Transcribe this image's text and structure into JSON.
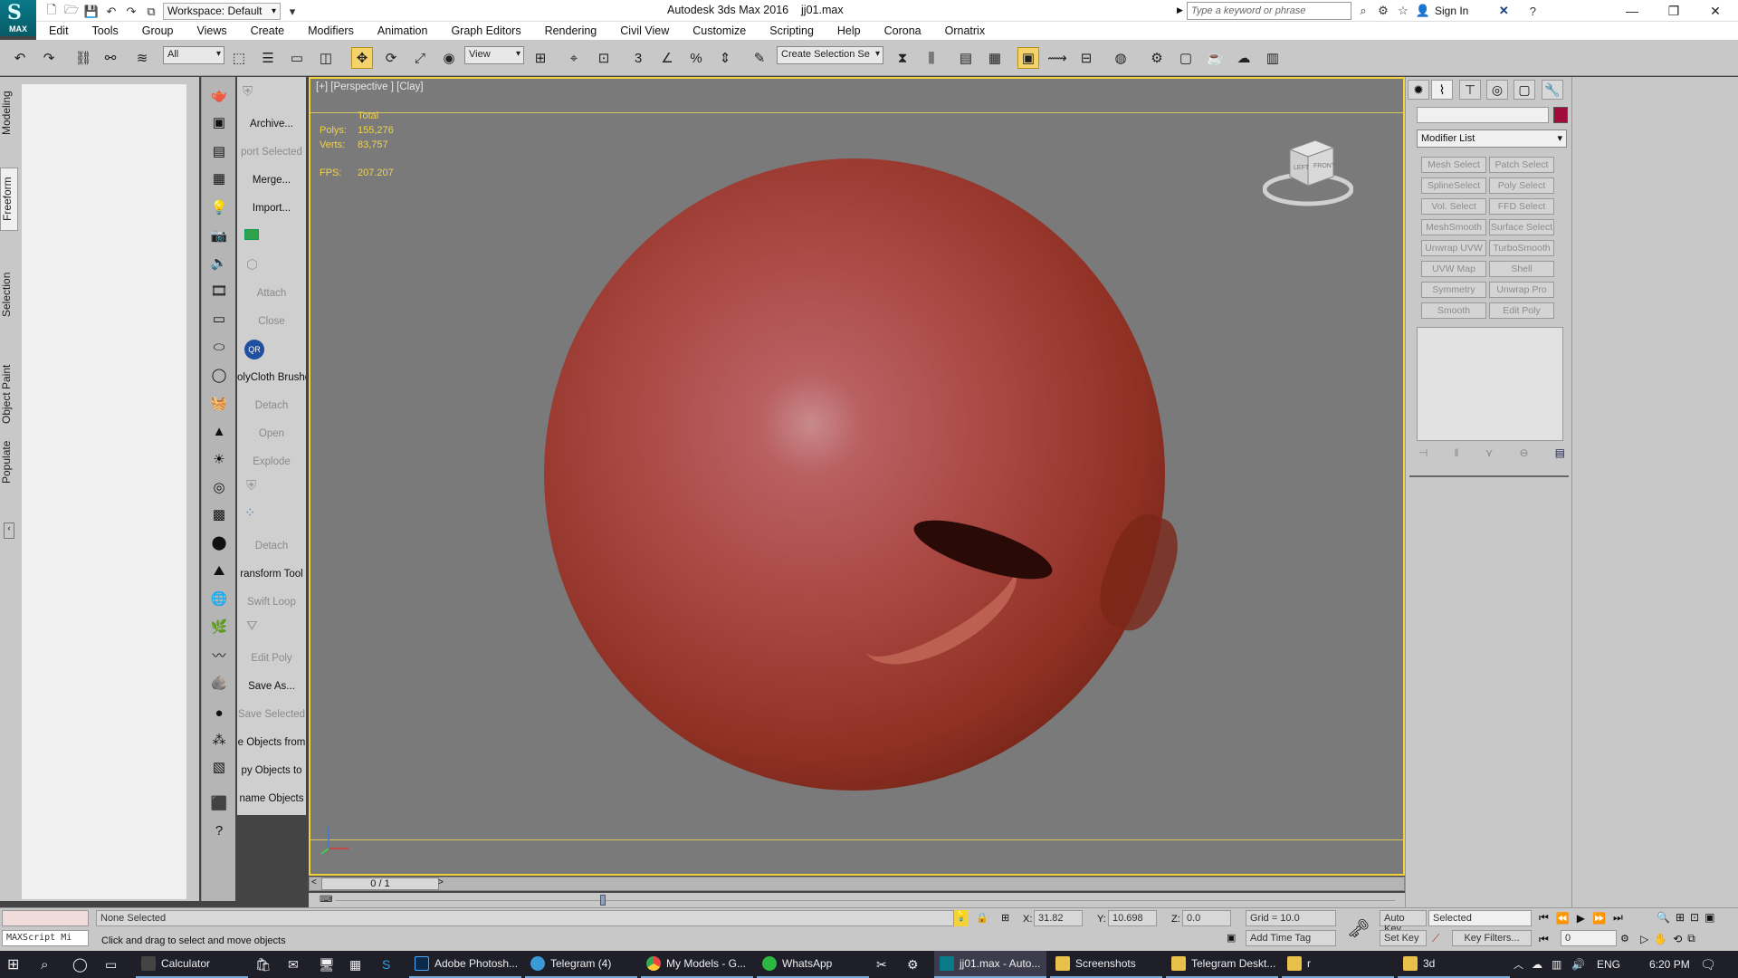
{
  "window": {
    "title": "Autodesk 3ds Max 2016",
    "file": "jj01.max",
    "logo_text": "MAX",
    "workspace": "Workspace: Default",
    "search_placeholder": "Type a keyword or phrase",
    "sign_in": "Sign In"
  },
  "menu": [
    "Edit",
    "Tools",
    "Group",
    "Views",
    "Create",
    "Modifiers",
    "Animation",
    "Graph Editors",
    "Rendering",
    "Civil View",
    "Customize",
    "Scripting",
    "Help",
    "Corona",
    "Ornatrix"
  ],
  "toolbar": {
    "filter_select": "All",
    "ref_coord": "View",
    "selection_set": "Create Selection Se",
    "snap_label": "3"
  },
  "ribbon_tabs": [
    "Modeling",
    "Freeform",
    "Selection",
    "Object Paint",
    "Populate"
  ],
  "ribbon_selected": "Freeform",
  "commands": [
    {
      "label": "Archive...",
      "dim": false
    },
    {
      "label": "port Selected",
      "dim": true
    },
    {
      "label": "Merge...",
      "dim": false
    },
    {
      "label": "Import...",
      "dim": false
    },
    {
      "label": "Attach",
      "dim": true
    },
    {
      "label": "Close",
      "dim": true
    },
    {
      "label": "olyCloth Brushe",
      "dim": false
    },
    {
      "label": "Detach",
      "dim": true
    },
    {
      "label": "Open",
      "dim": true
    },
    {
      "label": "Explode",
      "dim": true
    },
    {
      "label": "Detach",
      "dim": true
    },
    {
      "label": "ransform Tool",
      "dim": false
    },
    {
      "label": "Swift Loop",
      "dim": true
    },
    {
      "label": "Edit Poly",
      "dim": true
    },
    {
      "label": "Save As...",
      "dim": false
    },
    {
      "label": "Save Selected",
      "dim": true
    },
    {
      "label": "e Objects from",
      "dim": false
    },
    {
      "label": "py Objects to",
      "dim": false
    },
    {
      "label": "name Objects",
      "dim": false
    }
  ],
  "viewport": {
    "label": "[+] [Perspective ] [Clay]",
    "stats_total": "Total",
    "polys_label": "Polys:",
    "polys": "155,276",
    "verts_label": "Verts:",
    "verts": "83,757",
    "fps_label": "FPS:",
    "fps": "207.207",
    "viewcube_left": "LEFT",
    "viewcube_front": "FRONT",
    "object_color": "#a84640"
  },
  "timeslider": {
    "frame": "0 / 1"
  },
  "modifier_panel": {
    "object_color": "#a10c3a",
    "modifier_list": "Modifier List",
    "buttons": [
      [
        "Mesh Select",
        "Patch Select"
      ],
      [
        "SplineSelect",
        "Poly Select"
      ],
      [
        "Vol. Select",
        "FFD Select"
      ],
      [
        "MeshSmooth",
        "Surface Select"
      ],
      [
        "Unwrap UVW",
        "TurboSmooth"
      ],
      [
        "UVW Map",
        "Shell"
      ],
      [
        "Symmetry",
        "Unwrap Pro"
      ],
      [
        "Smooth",
        "Edit Poly"
      ]
    ]
  },
  "status": {
    "maxscript": "MAXScript Mi",
    "selection": "None Selected",
    "prompt": "Click and drag to select and move objects",
    "x_label": "X:",
    "x": "31.82",
    "y_label": "Y:",
    "y": "10.698",
    "z_label": "Z:",
    "z": "0.0",
    "grid": "Grid = 10.0",
    "add_time_tag": "Add Time Tag",
    "auto_key": "Auto Key",
    "set_key": "Set Key",
    "selected": "Selected",
    "key_filters": "Key Filters...",
    "frame_field": "0"
  },
  "taskbar": {
    "items": [
      "Calculator",
      "Adobe Photosh...",
      "Telegram (4)",
      "My Models - G...",
      "WhatsApp",
      "jj01.max - Auto...",
      "Screenshots",
      "Telegram Deskt...",
      "r",
      "3d"
    ],
    "lang": "ENG",
    "time": "6:20 PM"
  }
}
